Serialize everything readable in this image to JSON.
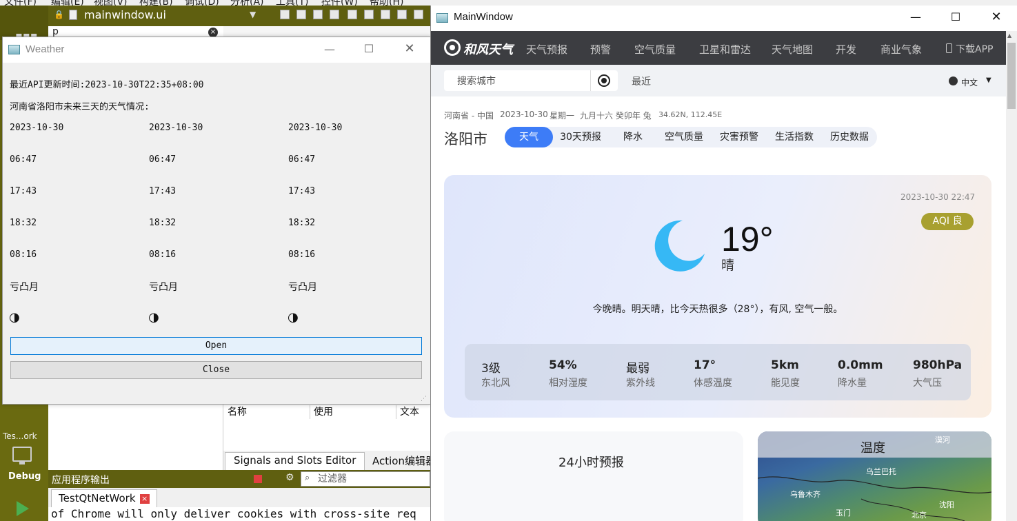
{
  "qtcreator": {
    "menu": [
      "文件(F)",
      "编辑(E)",
      "视图(V)",
      "构建(B)",
      "调试(D)",
      "分析(A)",
      "工具(T)",
      "控件(W)",
      "帮助(H)"
    ],
    "open_file": "mainwindow.ui",
    "filter_text": "p",
    "table_headers": [
      "名称",
      "使用",
      "文本"
    ],
    "bottom_tabs": [
      "Signals and Slots Editor",
      "Action编辑器"
    ],
    "sidebar_project": "Tes...ork",
    "sidebar_mode": "Debug",
    "output_title": "应用程序输出",
    "output_filter_placeholder": "过滤器",
    "output_tab": "TestQtNetWork",
    "console_text": "of Chrome will only deliver cookies with cross-site req"
  },
  "weather_dialog": {
    "title": "Weather",
    "update_line": "最近API更新时间:2023-10-30T22:35+08:00",
    "heading": "河南省洛阳市未来三天的天气情况:",
    "days": [
      {
        "date": "2023-10-30",
        "sunrise": "06:47",
        "sunset": "17:43",
        "moonrise": "18:32",
        "moonset": "08:16",
        "phase": "亏凸月",
        "phase_icon": "◑"
      },
      {
        "date": "2023-10-30",
        "sunrise": "06:47",
        "sunset": "17:43",
        "moonrise": "18:32",
        "moonset": "08:16",
        "phase": "亏凸月",
        "phase_icon": "◑"
      },
      {
        "date": "2023-10-30",
        "sunrise": "06:47",
        "sunset": "17:43",
        "moonrise": "18:32",
        "moonset": "08:16",
        "phase": "亏凸月",
        "phase_icon": "◑"
      }
    ],
    "open_label": "Open",
    "close_label": "Close"
  },
  "main_window": {
    "title": "MainWindow",
    "brand": "和风天气",
    "nav": [
      "天气预报",
      "预警",
      "空气质量",
      "卫星和雷达",
      "天气地图",
      "开发",
      "商业气象",
      "下载APP"
    ],
    "search_placeholder": "搜索城市",
    "recent": "最近",
    "language": "中文",
    "location": {
      "region": "河南省 - 中国",
      "date": "2023-10-30",
      "weekday": "星期一",
      "lunar": "九月十六 癸卯年 兔",
      "coords": "34.62N, 112.45E"
    },
    "city": "洛阳市",
    "tabs": [
      "天气",
      "30天预报",
      "降水",
      "空气质量",
      "灾害预警",
      "生活指数",
      "历史数据"
    ],
    "obs_time": "2023-10-30 22:47",
    "aqi": "AQI 良",
    "temperature": "19°",
    "condition": "晴",
    "summary": "今晚晴。明天晴，比今天热很多（28°），有风, 空气一般。",
    "details": [
      {
        "value": "3级",
        "label": "东北风"
      },
      {
        "value": "54%",
        "label": "相对湿度"
      },
      {
        "value": "最弱",
        "label": "紫外线"
      },
      {
        "value": "17°",
        "label": "体感温度"
      },
      {
        "value": "5km",
        "label": "能见度"
      },
      {
        "value": "0.0mm",
        "label": "降水量"
      },
      {
        "value": "980hPa",
        "label": "大气压"
      }
    ],
    "hourly_title": "24小时预报",
    "map_title": "温度",
    "map_labels": [
      "漠河",
      "乌兰巴托",
      "乌鲁木齐",
      "玉门",
      "北京",
      "沈阳"
    ]
  },
  "colors": {
    "accent": "#3d7cf7",
    "aqi": "#a8a030",
    "nav_bg": "#3c3d41",
    "moon": "#36b8f5",
    "qt_sidebar": "#6a6a10"
  }
}
